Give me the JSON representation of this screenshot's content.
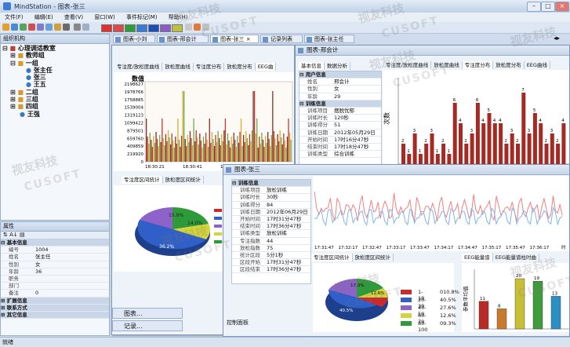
{
  "app": {
    "title": "MindStation - 图表-张三"
  },
  "menu": [
    "文件(F)",
    "编辑(E)",
    "查看(V)",
    "窗口(W)",
    "事件标记(M)",
    "帮助(H)"
  ],
  "toolbar_colors": [
    "#e03030",
    "#d94a4a",
    "#2f9b3a",
    "#3a7bd5",
    "#1a4fb5",
    "#8b5cc7",
    "#c0c040"
  ],
  "doc_tabs": [
    "图表-小刘",
    "图表-邢会计",
    "图表-张三",
    "记录列表",
    "图表-张主任"
  ],
  "org_panel": {
    "title": "组织机构",
    "tree": [
      "心理调适教室",
      "教师组",
      "一组",
      "张主任",
      "张三",
      "王五",
      "二组",
      "三组",
      "四组",
      "王强"
    ]
  },
  "prop_panel": {
    "title": "属性",
    "section_basic": "基本信息",
    "rows": [
      {
        "k": "编号",
        "v": "1004"
      },
      {
        "k": "姓名",
        "v": "张主任"
      },
      {
        "k": "性别",
        "v": "女"
      },
      {
        "k": "年龄",
        "v": "36"
      },
      {
        "k": "职务",
        "v": ""
      },
      {
        "k": "部门",
        "v": ""
      },
      {
        "k": "备注",
        "v": "0"
      }
    ],
    "section_ext": "扩展信息",
    "section_contact": "联系方式",
    "section_other": "其它信息"
  },
  "win_main": {
    "tabs": [
      "专注度/放松度曲线",
      "放松度曲线",
      "专注度分布",
      "放松度分布",
      "EEG曲"
    ],
    "y_label": "数值",
    "y_ticks": [
      "2198627",
      "1978766",
      "1758885",
      "1539004",
      "1319123",
      "1099422",
      "879501",
      "659760",
      "409859",
      "219920",
      "0"
    ],
    "x_ticks": [
      "18:30:21",
      "18:30:41",
      "18:31:21",
      "18:31:51"
    ],
    "sub_tabs": [
      "专注度区间统计",
      "放松度区间统计"
    ],
    "pie_labels": [
      "15.9%",
      "14.0%",
      "36.2%"
    ]
  },
  "win_xing": {
    "title": "图表-邢会计",
    "tabs": [
      "基本信息",
      "数据分析"
    ],
    "chart_tabs": [
      "专注度/放松度曲线",
      "放松度曲线",
      "专注度分布",
      "放松度分布",
      "EEG曲线"
    ],
    "section_user": "用户信息",
    "user_rows": [
      {
        "k": "姓名",
        "v": "邢会计"
      },
      {
        "k": "性别",
        "v": "女"
      },
      {
        "k": "年龄",
        "v": "29"
      }
    ],
    "section_train": "训练信息",
    "train_rows": [
      {
        "k": "训练项目",
        "v": "摆脱忧郁"
      },
      {
        "k": "训练时长",
        "v": "120秒"
      },
      {
        "k": "训练得分",
        "v": "51"
      },
      {
        "k": "训练日期",
        "v": "2012年05月29日"
      },
      {
        "k": "开始时间",
        "v": "17时16分47秒"
      },
      {
        "k": "结束时间",
        "v": "17时18分47秒"
      },
      {
        "k": "训练类型",
        "v": "综合训练"
      }
    ],
    "y_label": "次数"
  },
  "win_zhang": {
    "title": "图表-张三",
    "section": "训练信息",
    "rows": [
      {
        "k": "训练项目",
        "v": "放松训练"
      },
      {
        "k": "训练时长",
        "v": "30秒"
      },
      {
        "k": "训练得分",
        "v": "84"
      },
      {
        "k": "训练日期",
        "v": "2012年06月29日"
      },
      {
        "k": "开始时间",
        "v": "17时31分47秒"
      },
      {
        "k": "结束时间",
        "v": "17时36分47秒"
      },
      {
        "k": "训练类型",
        "v": "放松训练"
      },
      {
        "k": "专注指数",
        "v": "44"
      },
      {
        "k": "放松指数",
        "v": "75"
      },
      {
        "k": "统计区段",
        "v": "5分1秒"
      },
      {
        "k": "区段开始",
        "v": "17时31分47秒"
      },
      {
        "k": "区段结束",
        "v": "17时36分47秒"
      }
    ],
    "x_ticks": [
      "17:31:47",
      "17:32:17",
      "17:32:47",
      "17:33:17",
      "17:33:47",
      "17:34:17",
      "17:34:47",
      "17:35:17",
      "17:35:47",
      "17:36:17"
    ],
    "x_end": "时",
    "sub_tabs": [
      "专注度区间统计",
      "放松度区间统计"
    ],
    "pie_labels": [
      "17.3%",
      "12.6%",
      "40.5%"
    ],
    "legend": [
      {
        "label": "1-19",
        "pct": "010.8%",
        "color": "#cc2a2a"
      },
      {
        "label": "20-39",
        "pct": "40.5%",
        "color": "#2f5fc7"
      },
      {
        "label": "40-59",
        "pct": "27.6%",
        "color": "#8d62c9"
      },
      {
        "label": "60-79",
        "pct": "12.6%",
        "color": "#d4d43c"
      },
      {
        "label": "80-100",
        "pct": "09.3%",
        "color": "#2e9a3a"
      }
    ],
    "eeg_tabs": [
      "EEG能量谱",
      "EEG能量谱柱时曲"
    ],
    "eeg_ylabel": "参数平均值"
  },
  "minimized": [
    "图表...",
    "记录..."
  ],
  "control_panel": "控制面板",
  "status": "就绪",
  "watermark": [
    "视友科技",
    "CUSOFT"
  ],
  "chart_data": [
    {
      "type": "bar",
      "title": "",
      "ylabel": "次数",
      "values": [
        2,
        1,
        3,
        1,
        2,
        3,
        1,
        2,
        1,
        6,
        4,
        2,
        3,
        6,
        4,
        5,
        4,
        4,
        2,
        3,
        2,
        7,
        3,
        5,
        4,
        2,
        3,
        2,
        4
      ]
    },
    {
      "type": "bar",
      "title": "",
      "ylabel": "参数平均值",
      "categories": [
        "1",
        "2",
        "3",
        "4",
        "5"
      ],
      "values": [
        11,
        8,
        20,
        19,
        13
      ],
      "colors": [
        "#b82a25",
        "#c87a2c",
        "#c8c034",
        "#3f9b3c",
        "#2c8fc4"
      ]
    }
  ]
}
